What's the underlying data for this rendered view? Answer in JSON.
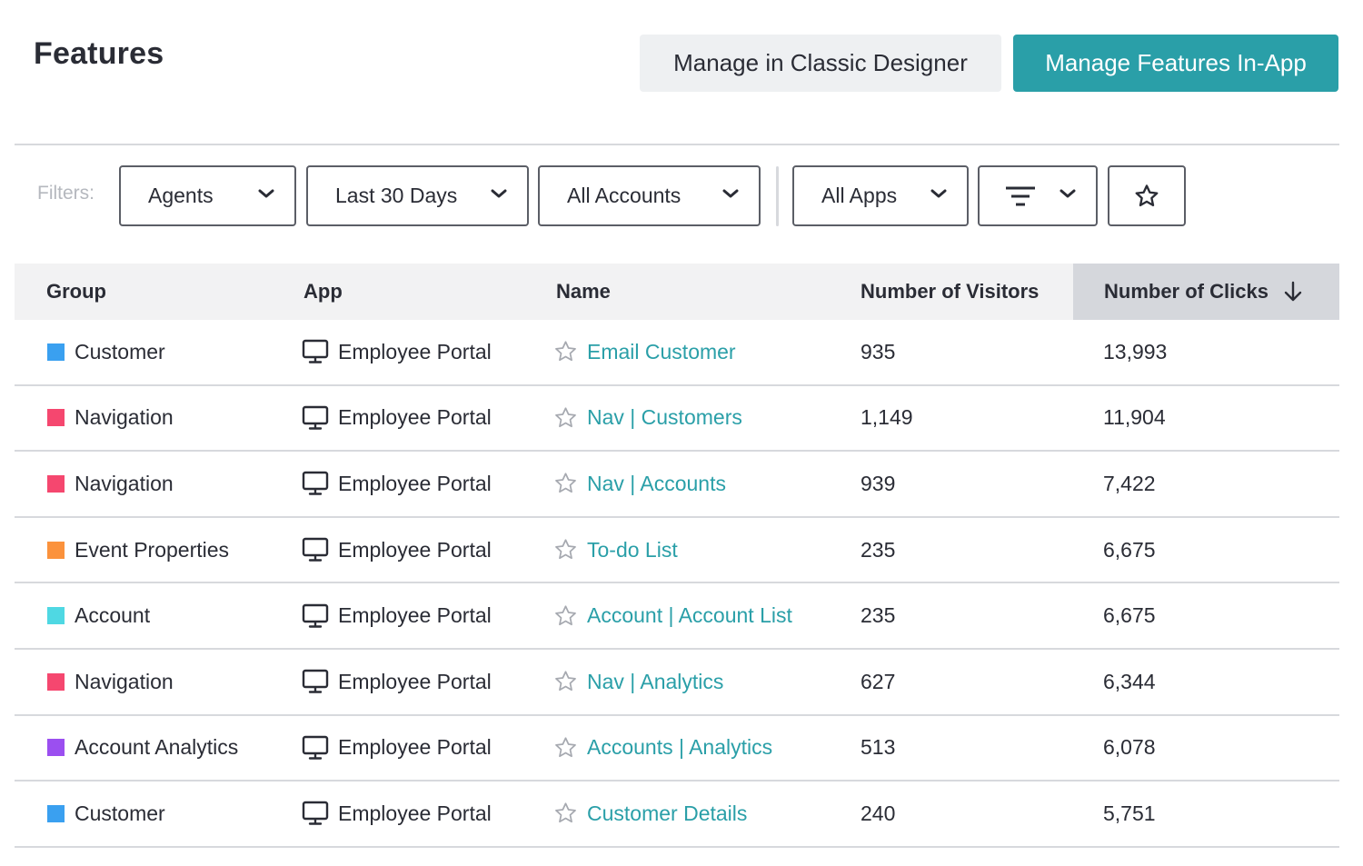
{
  "header": {
    "title": "Features",
    "classic_button": "Manage in Classic Designer",
    "inapp_button": "Manage Features In-App"
  },
  "filters": {
    "label": "Filters:",
    "segment": "Agents",
    "date_range": "Last 30 Days",
    "accounts": "All Accounts",
    "apps": "All Apps"
  },
  "table": {
    "columns": {
      "group": "Group",
      "app": "App",
      "name": "Name",
      "visitors": "Number of Visitors",
      "clicks": "Number of Clicks"
    },
    "sort": {
      "column": "clicks",
      "direction": "descending"
    },
    "rows": [
      {
        "group": "Customer",
        "group_color": "#3aa0f0",
        "app": "Employee Portal",
        "name": "Email Customer",
        "visitors": "935",
        "clicks": "13,993"
      },
      {
        "group": "Navigation",
        "group_color": "#f5476f",
        "app": "Employee Portal",
        "name": "Nav | Customers",
        "visitors": "1,149",
        "clicks": "11,904"
      },
      {
        "group": "Navigation",
        "group_color": "#f5476f",
        "app": "Employee Portal",
        "name": "Nav | Accounts",
        "visitors": "939",
        "clicks": "7,422"
      },
      {
        "group": "Event Properties",
        "group_color": "#fb923c",
        "app": "Employee Portal",
        "name": "To-do List",
        "visitors": "235",
        "clicks": "6,675"
      },
      {
        "group": "Account",
        "group_color": "#4fd8e3",
        "app": "Employee Portal",
        "name": "Account | Account List",
        "visitors": "235",
        "clicks": "6,675"
      },
      {
        "group": "Navigation",
        "group_color": "#f5476f",
        "app": "Employee Portal",
        "name": "Nav | Analytics",
        "visitors": "627",
        "clicks": "6,344"
      },
      {
        "group": "Account Analytics",
        "group_color": "#9b4ff0",
        "app": "Employee Portal",
        "name": "Accounts | Analytics",
        "visitors": "513",
        "clicks": "6,078"
      },
      {
        "group": "Customer",
        "group_color": "#3aa0f0",
        "app": "Employee Portal",
        "name": "Customer Details",
        "visitors": "240",
        "clicks": "5,751"
      }
    ]
  },
  "icons": {
    "select_chevron": "chevron-down-icon",
    "filter": "filter-lines-icon",
    "favorite": "star-outline-icon",
    "app": "desktop-monitor-icon",
    "sort": "arrow-down-icon"
  },
  "colors": {
    "accent": "#2a9fa8",
    "sorted_header_bg": "#d5d7dc",
    "header_bg": "#f2f2f3"
  }
}
